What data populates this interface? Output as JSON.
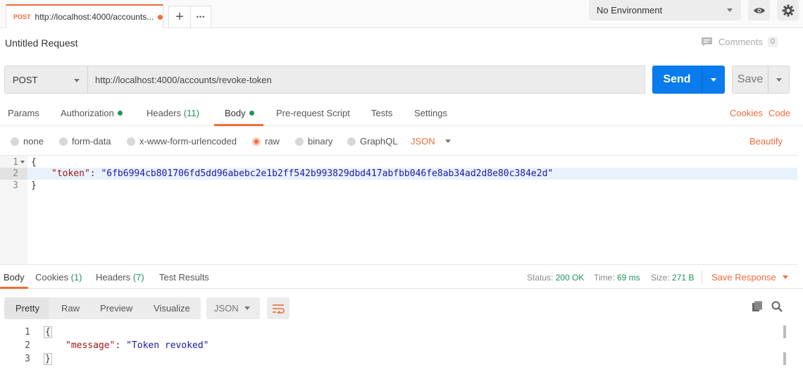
{
  "tabs": {
    "active": {
      "method": "POST",
      "url": "http://localhost:4000/accounts..."
    },
    "new_tab_glyph": "+",
    "more_glyph": "•••"
  },
  "environment": {
    "selected": "No Environment"
  },
  "request": {
    "title": "Untitled Request",
    "comments_label": "Comments",
    "comments_count": "0",
    "method": "POST",
    "url": "http://localhost:4000/accounts/revoke-token",
    "send_label": "Send",
    "save_label": "Save"
  },
  "request_tabs": {
    "params": "Params",
    "authorization": "Authorization",
    "headers": "Headers",
    "headers_count": "(11)",
    "body": "Body",
    "prerequest": "Pre-request Script",
    "tests": "Tests",
    "settings": "Settings",
    "cookies": "Cookies",
    "code": "Code"
  },
  "body_types": {
    "none": "none",
    "form_data": "form-data",
    "urlencoded": "x-www-form-urlencoded",
    "raw": "raw",
    "binary": "binary",
    "graphql": "GraphQL",
    "format": "JSON",
    "beautify": "Beautify"
  },
  "request_body": {
    "lines": [
      {
        "num": "1",
        "text": "{"
      },
      {
        "num": "2",
        "key": "\"token\"",
        "sep": ": ",
        "value": "\"6fb6994cb801706fd5dd96abebc2e1b2ff542b993829dbd417abfbb046fe8ab34ad2d8e80c384e2d\""
      },
      {
        "num": "3",
        "text": "}"
      }
    ]
  },
  "response_tabs": {
    "body": "Body",
    "cookies": "Cookies",
    "cookies_count": "(1)",
    "headers": "Headers",
    "headers_count": "(7)",
    "test_results": "Test Results",
    "status_label": "Status:",
    "status_value": "200 OK",
    "time_label": "Time:",
    "time_value": "69 ms",
    "size_label": "Size:",
    "size_value": "271 B",
    "save_response": "Save Response"
  },
  "response_view": {
    "pretty": "Pretty",
    "raw": "Raw",
    "preview": "Preview",
    "visualize": "Visualize",
    "format": "JSON"
  },
  "response_body": {
    "lines": [
      {
        "num": "1",
        "text": "{"
      },
      {
        "num": "2",
        "key": "\"message\"",
        "sep": ": ",
        "value": "\"Token revoked\""
      },
      {
        "num": "3",
        "text": "}"
      }
    ]
  },
  "colors": {
    "accent": "#f26b3a",
    "send": "#097bed",
    "status_ok": "#21935b"
  }
}
